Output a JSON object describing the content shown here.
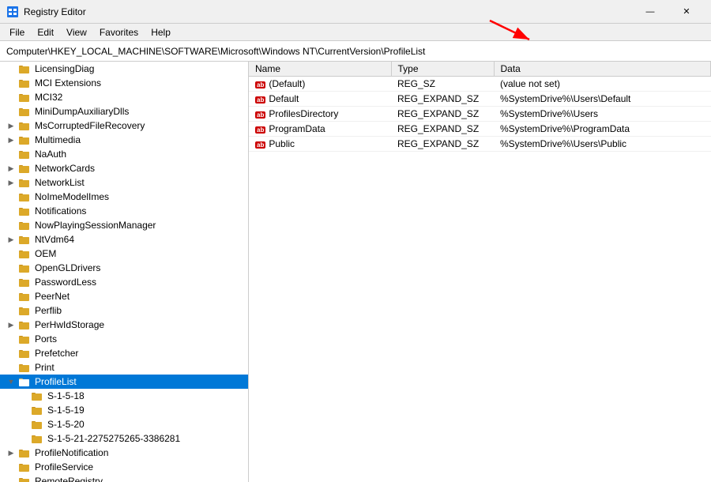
{
  "titleBar": {
    "title": "Registry Editor",
    "minimizeBtn": "—",
    "closeBtn": "✕"
  },
  "menuBar": {
    "items": [
      "File",
      "Edit",
      "View",
      "Favorites",
      "Help"
    ]
  },
  "addressBar": {
    "path": "Computer\\HKEY_LOCAL_MACHINE\\SOFTWARE\\Microsoft\\Windows NT\\CurrentVersion\\ProfileList"
  },
  "treeItems": [
    {
      "id": "LicensingDiag",
      "label": "LicensingDiag",
      "indent": 1,
      "expandable": false,
      "expanded": false
    },
    {
      "id": "MCIExtensions",
      "label": "MCI Extensions",
      "indent": 1,
      "expandable": false,
      "expanded": false
    },
    {
      "id": "MCI32",
      "label": "MCI32",
      "indent": 1,
      "expandable": false,
      "expanded": false
    },
    {
      "id": "MiniDumpAuxiliaryDlls",
      "label": "MiniDumpAuxiliaryDlls",
      "indent": 1,
      "expandable": false,
      "expanded": false
    },
    {
      "id": "MsCorruptedFileRecovery",
      "label": "MsCorruptedFileRecovery",
      "indent": 1,
      "expandable": true,
      "expanded": false
    },
    {
      "id": "Multimedia",
      "label": "Multimedia",
      "indent": 1,
      "expandable": true,
      "expanded": false
    },
    {
      "id": "NaAuth",
      "label": "NaAuth",
      "indent": 1,
      "expandable": false,
      "expanded": false
    },
    {
      "id": "NetworkCards",
      "label": "NetworkCards",
      "indent": 1,
      "expandable": true,
      "expanded": false
    },
    {
      "id": "NetworkList",
      "label": "NetworkList",
      "indent": 1,
      "expandable": true,
      "expanded": false
    },
    {
      "id": "NoImeModelImes",
      "label": "NoImeModelImes",
      "indent": 1,
      "expandable": false,
      "expanded": false
    },
    {
      "id": "Notifications",
      "label": "Notifications",
      "indent": 1,
      "expandable": false,
      "expanded": false
    },
    {
      "id": "NowPlayingSessionManager",
      "label": "NowPlayingSessionManager",
      "indent": 1,
      "expandable": false,
      "expanded": false
    },
    {
      "id": "NtVdm64",
      "label": "NtVdm64",
      "indent": 1,
      "expandable": true,
      "expanded": false
    },
    {
      "id": "OEM",
      "label": "OEM",
      "indent": 1,
      "expandable": false,
      "expanded": false
    },
    {
      "id": "OpenGLDrivers",
      "label": "OpenGLDrivers",
      "indent": 1,
      "expandable": false,
      "expanded": false
    },
    {
      "id": "PasswordLess",
      "label": "PasswordLess",
      "indent": 1,
      "expandable": false,
      "expanded": false
    },
    {
      "id": "PeerNet",
      "label": "PeerNet",
      "indent": 1,
      "expandable": false,
      "expanded": false
    },
    {
      "id": "Perflib",
      "label": "Perflib",
      "indent": 1,
      "expandable": false,
      "expanded": false
    },
    {
      "id": "PerHwIdStorage",
      "label": "PerHwIdStorage",
      "indent": 1,
      "expandable": true,
      "expanded": false
    },
    {
      "id": "Ports",
      "label": "Ports",
      "indent": 1,
      "expandable": false,
      "expanded": false
    },
    {
      "id": "Prefetcher",
      "label": "Prefetcher",
      "indent": 1,
      "expandable": false,
      "expanded": false
    },
    {
      "id": "Print",
      "label": "Print",
      "indent": 1,
      "expandable": false,
      "expanded": false
    },
    {
      "id": "ProfileList",
      "label": "ProfileList",
      "indent": 1,
      "expandable": true,
      "expanded": true,
      "selected": true
    },
    {
      "id": "S-1-5-18",
      "label": "S-1-5-18",
      "indent": 2,
      "expandable": false,
      "expanded": false
    },
    {
      "id": "S-1-5-19",
      "label": "S-1-5-19",
      "indent": 2,
      "expandable": false,
      "expanded": false
    },
    {
      "id": "S-1-5-20",
      "label": "S-1-5-20",
      "indent": 2,
      "expandable": false,
      "expanded": false
    },
    {
      "id": "S-1-5-21-long",
      "label": "S-1-5-21-2275275265-3386281",
      "indent": 2,
      "expandable": false,
      "expanded": false
    },
    {
      "id": "ProfileNotification",
      "label": "ProfileNotification",
      "indent": 1,
      "expandable": true,
      "expanded": false
    },
    {
      "id": "ProfileService",
      "label": "ProfileService",
      "indent": 1,
      "expandable": false,
      "expanded": false
    },
    {
      "id": "RemoteRegistry",
      "label": "RemoteRegistry",
      "indent": 1,
      "expandable": false,
      "expanded": false
    }
  ],
  "rightPanel": {
    "columns": [
      "Name",
      "Type",
      "Data"
    ],
    "rows": [
      {
        "name": "(Default)",
        "type": "REG_SZ",
        "data": "(value not set)"
      },
      {
        "name": "Default",
        "type": "REG_EXPAND_SZ",
        "data": "%SystemDrive%\\Users\\Default"
      },
      {
        "name": "ProfilesDirectory",
        "type": "REG_EXPAND_SZ",
        "data": "%SystemDrive%\\Users"
      },
      {
        "name": "ProgramData",
        "type": "REG_EXPAND_SZ",
        "data": "%SystemDrive%\\ProgramData"
      },
      {
        "name": "Public",
        "type": "REG_EXPAND_SZ",
        "data": "%SystemDrive%\\Users\\Public"
      }
    ]
  },
  "colors": {
    "selectedBg": "#0078d7",
    "selectedText": "#ffffff",
    "folderColor": "#dca829",
    "headerBg": "#f0f0f0"
  }
}
